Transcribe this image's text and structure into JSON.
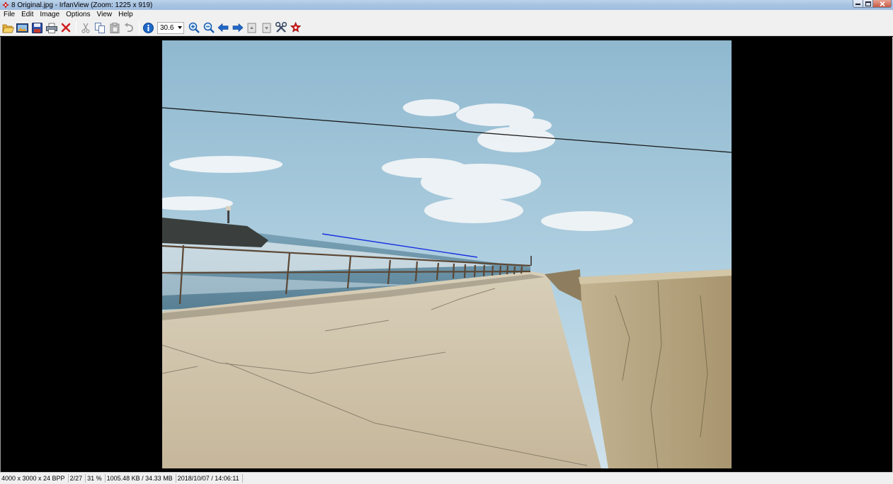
{
  "window": {
    "title": "8 Original.jpg - IrfanView (Zoom: 1225 x 919)",
    "app_icon": "irfanview-icon",
    "controls": {
      "minimize": "minimize-icon",
      "maximize": "maximize-icon",
      "close": "close-icon"
    }
  },
  "menu": [
    "File",
    "Edit",
    "Image",
    "Options",
    "View",
    "Help"
  ],
  "toolbar": {
    "buttons": [
      "open-folder-icon",
      "thumbnails-icon",
      "save-icon",
      "print-icon",
      "delete-icon",
      "cut-icon",
      "copy-icon",
      "paste-icon",
      "undo-icon",
      "info-icon",
      "zoom-in-icon",
      "zoom-out-icon",
      "previous-icon",
      "next-icon",
      "first-page-icon",
      "last-page-icon",
      "settings-icon",
      "exit-icon"
    ],
    "zoom_value": "30.6"
  },
  "image": {
    "description_colors": {
      "sky": "#9cc4d9",
      "sea": "#5d8fa6",
      "concrete": "#cbbfa6",
      "wall": "#b5a47f"
    }
  },
  "status": {
    "dimensions": "4000 x 3000 x 24 BPP",
    "page": "2/27",
    "zoom": "31 %",
    "size": "1005.48 KB / 34.33 MB",
    "datetime": "2018/10/07 / 14:06:11"
  }
}
